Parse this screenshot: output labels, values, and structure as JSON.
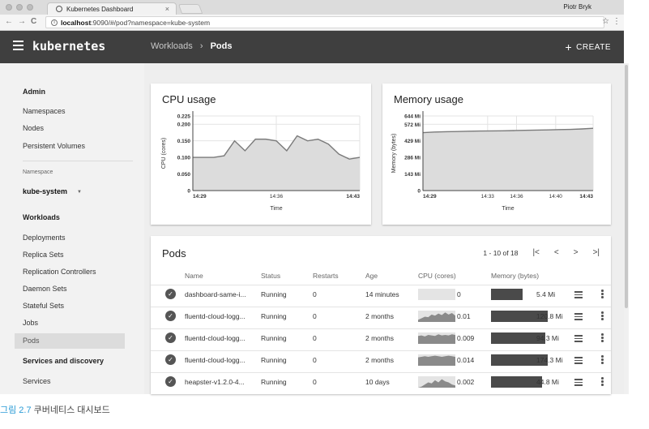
{
  "browser": {
    "tab_title": "Kubernetes Dashboard",
    "tab_close": "×",
    "profile": "Piotr Bryk",
    "url_host": "localhost",
    "url_rest": ":9090/#/pod?namespace=kube-system",
    "back": "←",
    "forward": "→",
    "reload": "C",
    "info": "i",
    "star": "☆",
    "menu": "⋮"
  },
  "header": {
    "brand": "kubernetes",
    "crumb_parent": "Workloads",
    "crumb_sep": "›",
    "crumb_current": "Pods",
    "create_plus": "+",
    "create_label": "CREATE"
  },
  "sidebar": {
    "admin_title": "Admin",
    "admin_items": [
      "Namespaces",
      "Nodes",
      "Persistent Volumes"
    ],
    "namespace_label": "Namespace",
    "namespace_value": "kube-system",
    "workloads_title": "Workloads",
    "workload_items": [
      "Deployments",
      "Replica Sets",
      "Replication Controllers",
      "Daemon Sets",
      "Stateful Sets",
      "Jobs",
      "Pods"
    ],
    "active_item": "Pods",
    "services_title": "Services and discovery",
    "services_items": [
      "Services"
    ]
  },
  "cpu_card": {
    "title": "CPU usage"
  },
  "memory_card": {
    "title": "Memory usage"
  },
  "chart_data": [
    {
      "type": "area",
      "title": "CPU usage",
      "xlabel": "Time",
      "ylabel": "CPU (cores)",
      "x_ticks": [
        "14:29",
        "14:36",
        "14:43"
      ],
      "y_ticks": [
        "0",
        "0.050",
        "0.100",
        "0.150",
        "0.200",
        "0.225"
      ],
      "ylim": [
        0,
        0.225
      ],
      "grid": true,
      "series": [
        {
          "values": [
            0.1,
            0.1,
            0.1,
            0.105,
            0.15,
            0.12,
            0.155,
            0.155,
            0.15,
            0.12,
            0.165,
            0.15,
            0.155,
            0.14,
            0.11,
            0.095,
            0.1
          ]
        }
      ]
    },
    {
      "type": "area",
      "title": "Memory usage",
      "xlabel": "Time",
      "ylabel": "Memory (bytes)",
      "x_ticks": [
        "14:29",
        "14:33",
        "14:36",
        "14:40",
        "14:43"
      ],
      "y_ticks": [
        "0",
        "143 Mi",
        "286 Mi",
        "429 Mi",
        "572 Mi",
        "644 Mi"
      ],
      "ylim": [
        0,
        644
      ],
      "grid": true,
      "series": [
        {
          "values": [
            500,
            505,
            508,
            510,
            512,
            514,
            515,
            516,
            518,
            520,
            522,
            524,
            526,
            528,
            532,
            538
          ]
        }
      ]
    }
  ],
  "pods": {
    "title": "Pods",
    "pagination": "1 - 10 of 18",
    "first": "|<",
    "prev": "<",
    "next": ">",
    "last": ">|",
    "columns": [
      "Name",
      "Status",
      "Restarts",
      "Age",
      "CPU (cores)",
      "Memory (bytes)"
    ],
    "rows": [
      {
        "name": "dashboard-same-i...",
        "status": "Running",
        "restarts": "0",
        "age": "14 minutes",
        "cpu": "0",
        "memory": "5.4 Mi",
        "mem_level": 0.55,
        "cpu_spark": []
      },
      {
        "name": "fluentd-cloud-logg...",
        "status": "Running",
        "restarts": "0",
        "age": "2 months",
        "cpu": "0.01",
        "memory": "120.8 Mi",
        "mem_level": 1.0,
        "cpu_spark": [
          0.2,
          0.35,
          0.5,
          0.45,
          0.7,
          0.6,
          0.8,
          0.65,
          0.9,
          0.7,
          0.85,
          0.6
        ]
      },
      {
        "name": "fluentd-cloud-logg...",
        "status": "Running",
        "restarts": "0",
        "age": "2 months",
        "cpu": "0.009",
        "memory": "94.3 Mi",
        "mem_level": 0.95,
        "cpu_spark": [
          0.75,
          0.8,
          0.7,
          0.85,
          0.8,
          0.75,
          0.9,
          0.8,
          0.85,
          0.8,
          0.9,
          0.85
        ]
      },
      {
        "name": "fluentd-cloud-logg...",
        "status": "Running",
        "restarts": "0",
        "age": "2 months",
        "cpu": "0.014",
        "memory": "174.3 Mi",
        "mem_level": 1.0,
        "cpu_spark": [
          0.8,
          0.85,
          0.9,
          0.85,
          0.9,
          0.95,
          0.9,
          0.85,
          0.9,
          0.95,
          0.9,
          0.85
        ]
      },
      {
        "name": "heapster-v1.2.0-4...",
        "status": "Running",
        "restarts": "0",
        "age": "10 days",
        "cpu": "0.002",
        "memory": "44.8 Mi",
        "mem_level": 0.9,
        "cpu_spark": [
          0.0,
          0.1,
          0.3,
          0.5,
          0.4,
          0.7,
          0.5,
          0.8,
          0.6,
          0.5,
          0.3,
          0.2
        ]
      }
    ]
  },
  "caption": {
    "label": "그림 2.7",
    "text": "쿠버네티스 대시보드"
  },
  "colors": {
    "appbar": "#3f3f3f",
    "sidebar": "#f2f2f2",
    "chart_area": "#dcdcdc",
    "chart_line": "#7a7a7a",
    "caption_blue": "#2a9bd6"
  }
}
